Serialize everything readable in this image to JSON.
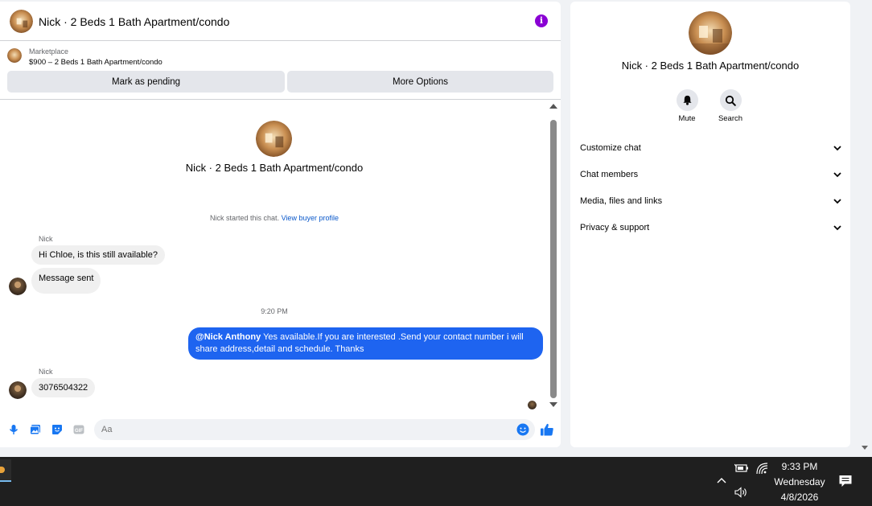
{
  "chat": {
    "title": "Nick · 2 Beds 1 Bath Apartment/condo",
    "marketplace_label": "Marketplace",
    "marketplace_item": "$900 – 2 Beds 1 Bath Apartment/condo",
    "mark_pending_label": "Mark as pending",
    "more_options_label": "More Options",
    "intro_title": "Nick · 2 Beds 1 Bath Apartment/condo",
    "system_note": "Nick started this chat.",
    "system_note_link": "View buyer profile",
    "messages": [
      {
        "sender": "Nick",
        "text": "Hi Chloe, is this still available?"
      },
      {
        "text": "Message sent"
      }
    ],
    "time_separator": "9:20 PM",
    "outgoing": {
      "mention": "@Nick Anthony",
      "text": " Yes available.If you are interested .Send your contact number i will share address,detail and schedule. Thanks"
    },
    "reply": {
      "sender": "Nick",
      "text": "3076504322"
    },
    "composer_placeholder": "Aa"
  },
  "info_panel": {
    "title": "Nick · 2 Beds 1 Bath Apartment/condo",
    "mute_label": "Mute",
    "search_label": "Search",
    "sections": [
      "Customize chat",
      "Chat members",
      "Media, files and links",
      "Privacy & support"
    ]
  },
  "taskbar": {
    "time": "9:33 PM",
    "day": "Wednesday",
    "date": "4/8/2026"
  },
  "colors": {
    "accent": "#1877f2",
    "outgoing_bubble": "#1e64f0",
    "info_icon": "#8a00d4"
  }
}
